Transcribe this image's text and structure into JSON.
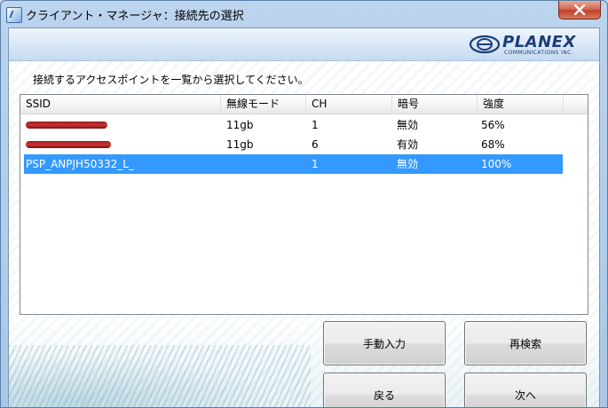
{
  "window": {
    "title": "クライアント・マネージャ：接続先の選択"
  },
  "logo": {
    "name": "PLANEX",
    "subtitle": "COMMUNICATIONS INC."
  },
  "instruction": "接続するアクセスポイントを一覧から選択してください。",
  "list": {
    "columns": [
      "SSID",
      "無線モード",
      "CH",
      "暗号",
      "強度"
    ],
    "rows": [
      {
        "ssid": "",
        "mode": "11gb",
        "ch": "1",
        "enc": "無効",
        "strength": "56%",
        "redacted": true,
        "selected": false
      },
      {
        "ssid": "",
        "mode": "11gb",
        "ch": "6",
        "enc": "有効",
        "strength": "68%",
        "redacted": true,
        "selected": false
      },
      {
        "ssid": "PSP_ANPJH50332_L_",
        "mode": "",
        "ch": "1",
        "enc": "無効",
        "strength": "100%",
        "redacted": false,
        "selected": true
      }
    ]
  },
  "buttons": {
    "manual": "手動入力",
    "rescan": "再検索",
    "back": "戻る",
    "next": "次へ"
  },
  "colors": {
    "selection": "#3399ff",
    "redaction": "#b22222",
    "logo_blue": "#1b3d7a"
  }
}
